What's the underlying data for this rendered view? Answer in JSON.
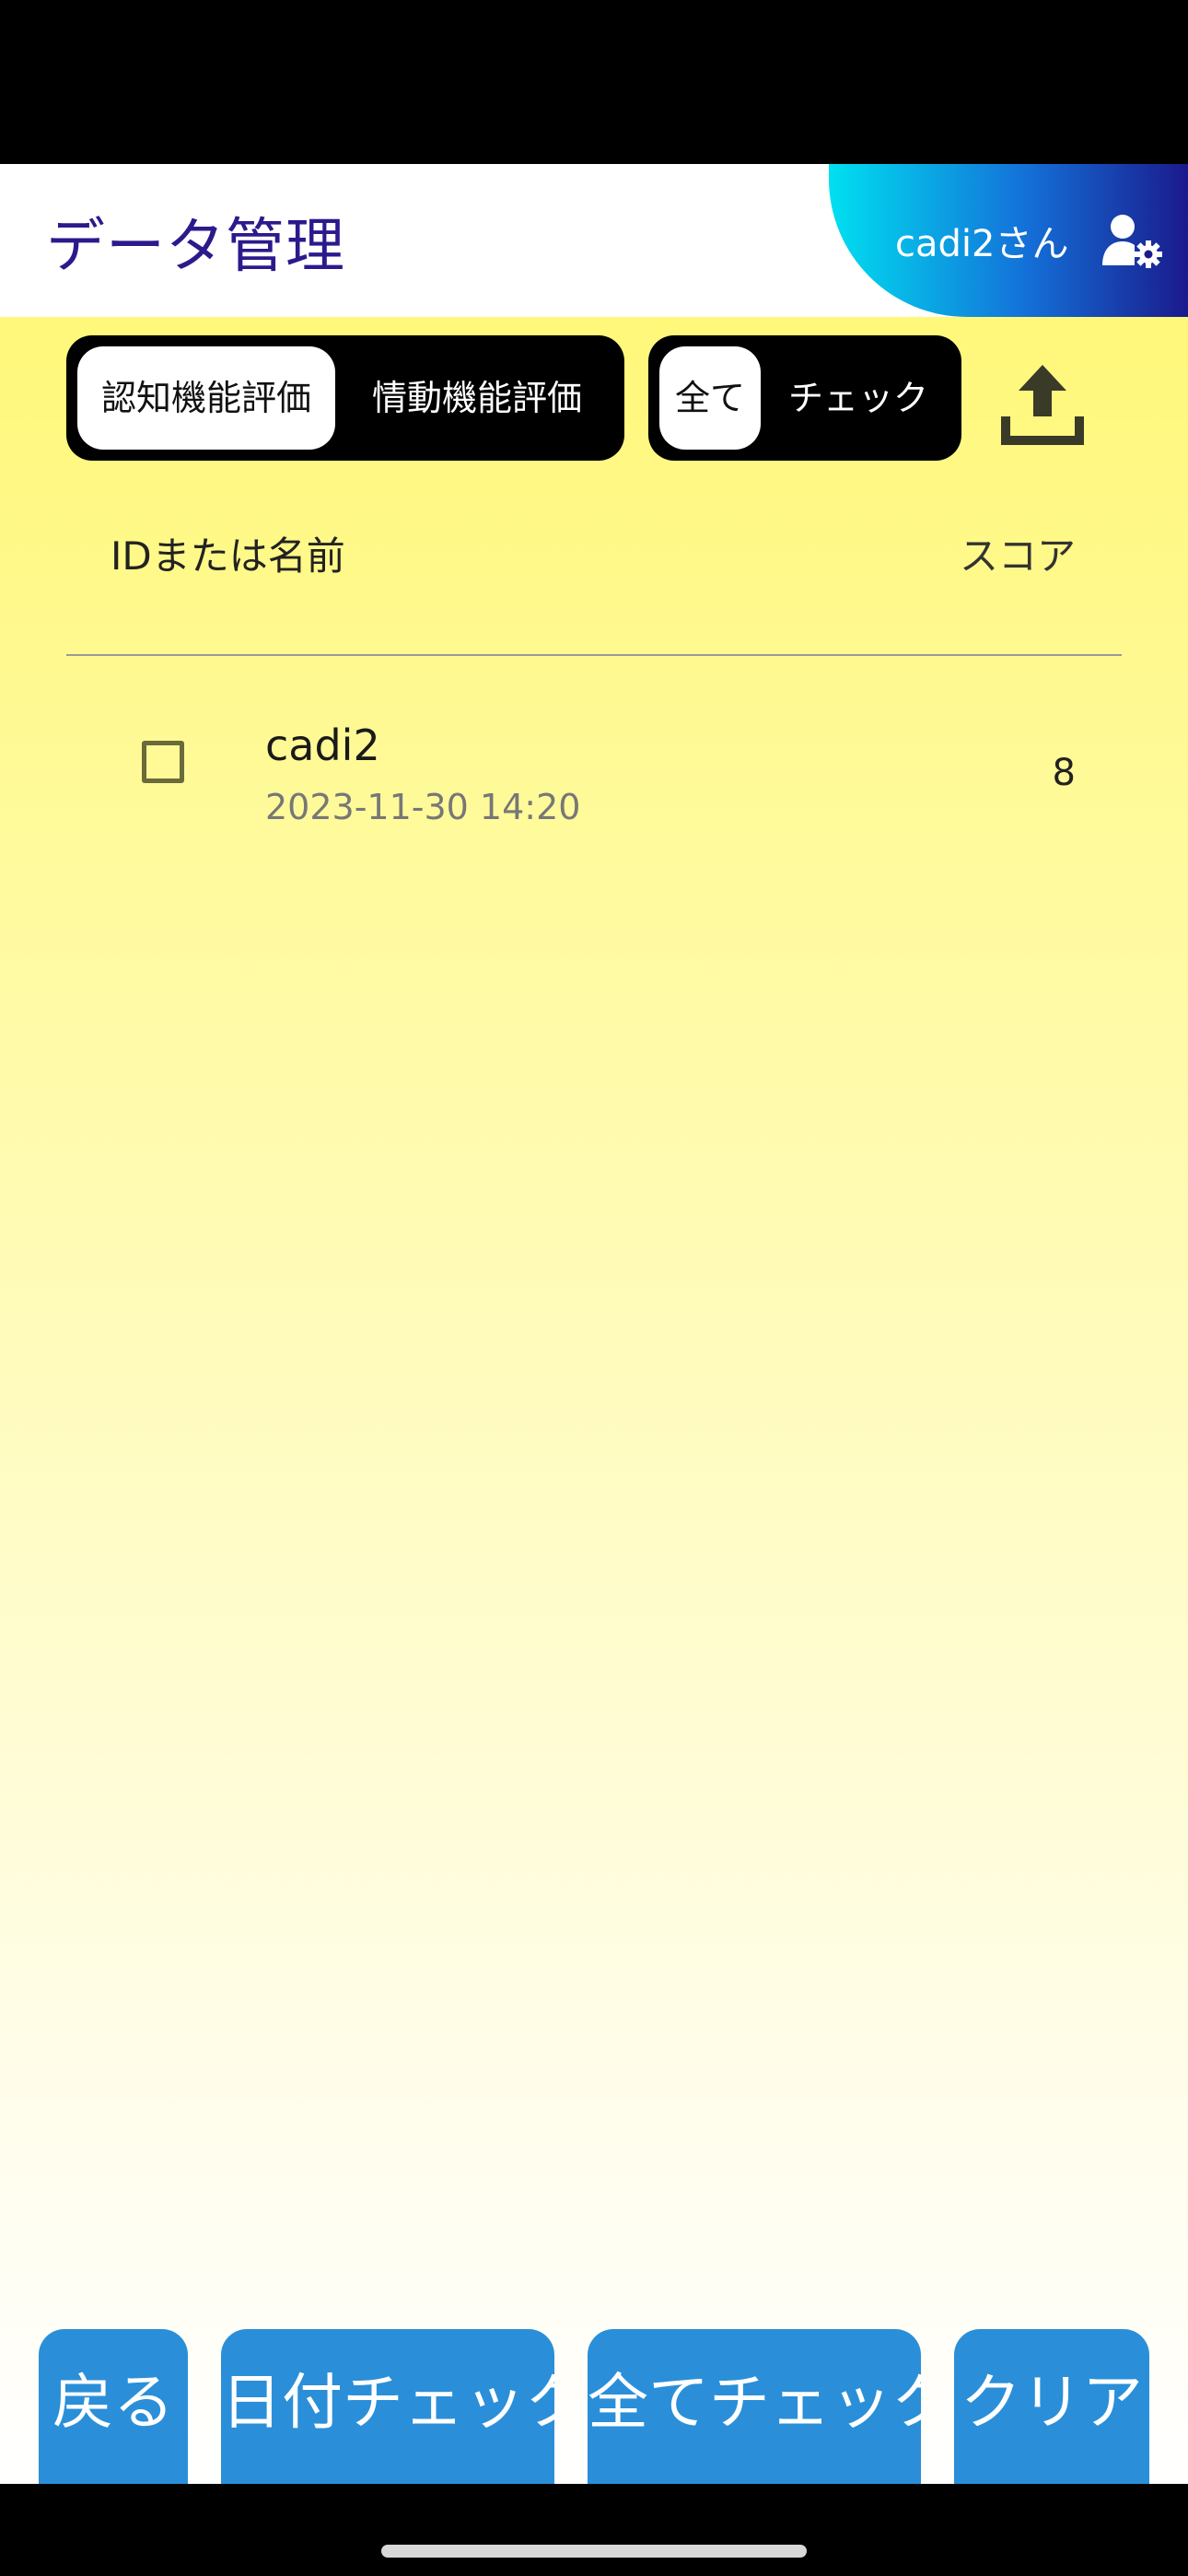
{
  "header": {
    "title": "データ管理",
    "user_label": "cadi2さん",
    "user_icon": "user-gear-icon"
  },
  "toolbar": {
    "eval_toggle": {
      "options": [
        "認知機能評価",
        "情動機能評価"
      ],
      "selected": "認知機能評価"
    },
    "filter_toggle": {
      "options": [
        "全て",
        "チェック"
      ],
      "selected": "全て"
    },
    "upload_icon": "upload-icon"
  },
  "list": {
    "headers": {
      "id_name": "IDまたは名前",
      "score": "スコア"
    },
    "rows": [
      {
        "name": "cadi2",
        "date": "2023-11-30 14:20",
        "score": "8",
        "checked": false
      }
    ]
  },
  "bottom_buttons": {
    "back": "戻る",
    "date_check": "日付チェック",
    "all_check": "全てチェック",
    "clear": "クリア"
  },
  "colors": {
    "title": "#2b1a8c",
    "button": "#2a8fd8",
    "background_top": "#fff87a",
    "background_bottom": "#ffffff",
    "badge_gradient": [
      "#00e0f0",
      "#1470d8",
      "#1a1a8c"
    ]
  }
}
